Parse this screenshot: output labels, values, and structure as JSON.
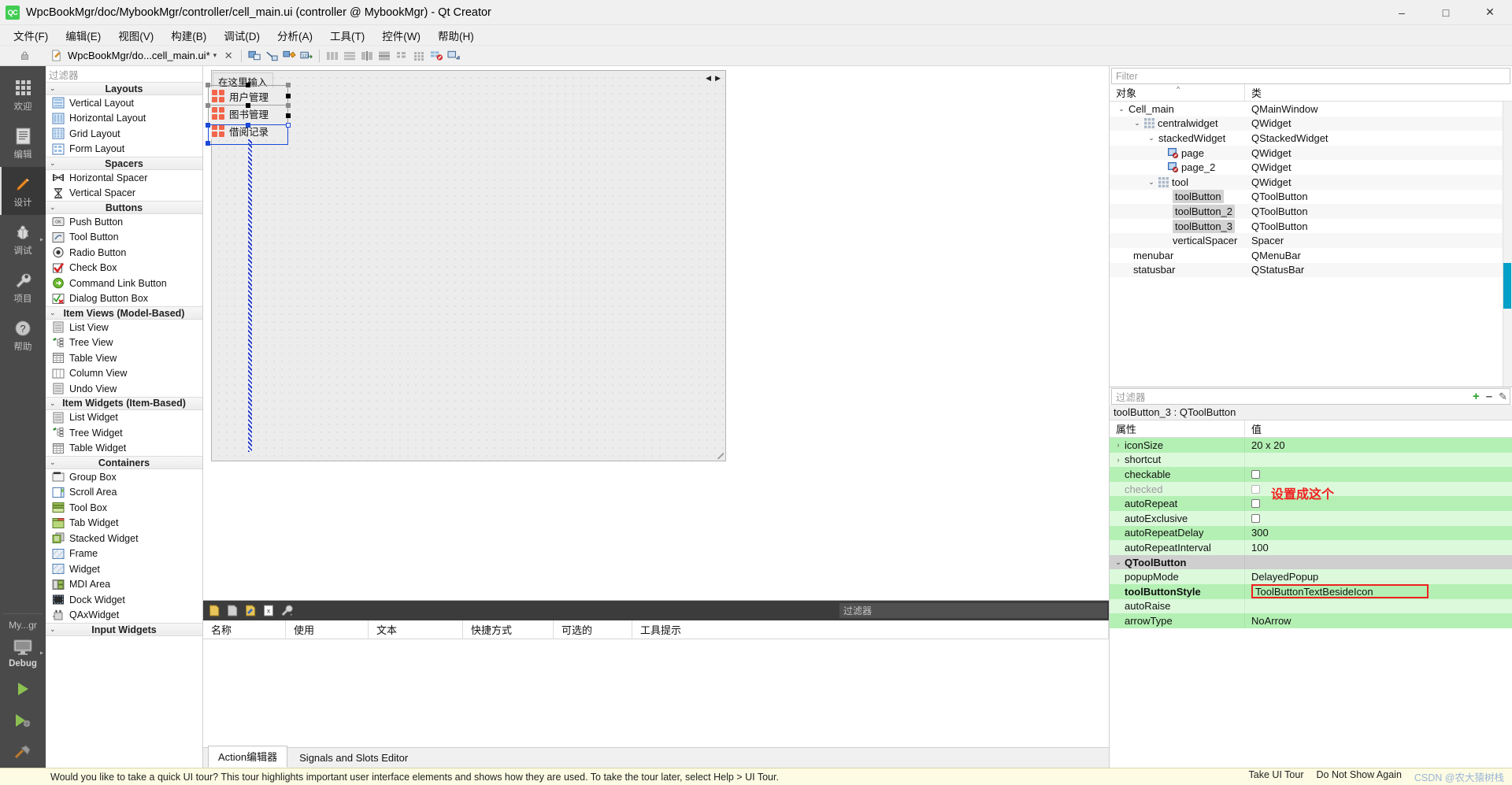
{
  "window": {
    "title": "WpcBookMgr/doc/MybookMgr/controller/cell_main.ui (controller @ MybookMgr) - Qt Creator",
    "logo": "QC",
    "minimize": "–",
    "maximize": "□",
    "close": "✕"
  },
  "menubar": [
    {
      "label": "文件(F)",
      "name": "menu-file"
    },
    {
      "label": "编辑(E)",
      "name": "menu-edit"
    },
    {
      "label": "视图(V)",
      "name": "menu-view"
    },
    {
      "label": "构建(B)",
      "name": "menu-build"
    },
    {
      "label": "调试(D)",
      "name": "menu-debug"
    },
    {
      "label": "分析(A)",
      "name": "menu-analyze"
    },
    {
      "label": "工具(T)",
      "name": "menu-tools"
    },
    {
      "label": "控件(W)",
      "name": "menu-widgets"
    },
    {
      "label": "帮助(H)",
      "name": "menu-help"
    }
  ],
  "toolbar": {
    "file_name": "WpcBookMgr/do...cell_main.ui*",
    "dropdown_glyph": "▾",
    "close_glyph": "✕"
  },
  "modebar": {
    "items": [
      {
        "label": "欢迎",
        "icon": "grid-icon",
        "active": false
      },
      {
        "label": "编辑",
        "icon": "document-icon",
        "active": false
      },
      {
        "label": "设计",
        "icon": "pencil-icon",
        "active": true
      },
      {
        "label": "调试",
        "icon": "bug-icon",
        "active": false,
        "arrow": "▸"
      },
      {
        "label": "项目",
        "icon": "wrench-icon",
        "active": false
      },
      {
        "label": "帮助",
        "icon": "question-icon",
        "active": false
      }
    ],
    "kit_label": "My...gr",
    "target_label": "Debug",
    "target_arrow": "▸"
  },
  "widgetbox": {
    "filter_placeholder": "过滤器",
    "groups": [
      {
        "title": "Layouts",
        "items": [
          {
            "label": "Vertical Layout",
            "icon": "vertical-layout-icon"
          },
          {
            "label": "Horizontal Layout",
            "icon": "horizontal-layout-icon"
          },
          {
            "label": "Grid Layout",
            "icon": "grid-layout-icon"
          },
          {
            "label": "Form Layout",
            "icon": "form-layout-icon"
          }
        ]
      },
      {
        "title": "Spacers",
        "items": [
          {
            "label": "Horizontal Spacer",
            "icon": "horizontal-spacer-icon"
          },
          {
            "label": "Vertical Spacer",
            "icon": "vertical-spacer-icon"
          }
        ]
      },
      {
        "title": "Buttons",
        "items": [
          {
            "label": "Push Button",
            "icon": "push-button-icon"
          },
          {
            "label": "Tool Button",
            "icon": "tool-button-icon"
          },
          {
            "label": "Radio Button",
            "icon": "radio-button-icon"
          },
          {
            "label": "Check Box",
            "icon": "check-box-icon"
          },
          {
            "label": "Command Link Button",
            "icon": "command-link-icon"
          },
          {
            "label": "Dialog Button Box",
            "icon": "dialog-button-box-icon"
          }
        ]
      },
      {
        "title": "Item Views (Model-Based)",
        "items": [
          {
            "label": "List View",
            "icon": "list-view-icon"
          },
          {
            "label": "Tree View",
            "icon": "tree-view-icon"
          },
          {
            "label": "Table View",
            "icon": "table-view-icon"
          },
          {
            "label": "Column View",
            "icon": "column-view-icon"
          },
          {
            "label": "Undo View",
            "icon": "undo-view-icon"
          }
        ]
      },
      {
        "title": "Item Widgets (Item-Based)",
        "items": [
          {
            "label": "List Widget",
            "icon": "list-widget-icon"
          },
          {
            "label": "Tree Widget",
            "icon": "tree-widget-icon"
          },
          {
            "label": "Table Widget",
            "icon": "table-widget-icon"
          }
        ]
      },
      {
        "title": "Containers",
        "items": [
          {
            "label": "Group Box",
            "icon": "group-box-icon"
          },
          {
            "label": "Scroll Area",
            "icon": "scroll-area-icon"
          },
          {
            "label": "Tool Box",
            "icon": "tool-box-icon"
          },
          {
            "label": "Tab Widget",
            "icon": "tab-widget-icon"
          },
          {
            "label": "Stacked Widget",
            "icon": "stacked-widget-icon"
          },
          {
            "label": "Frame",
            "icon": "frame-icon"
          },
          {
            "label": "Widget",
            "icon": "widget-icon"
          },
          {
            "label": "MDI Area",
            "icon": "mdi-area-icon"
          },
          {
            "label": "Dock Widget",
            "icon": "dock-widget-icon"
          },
          {
            "label": "QAxWidget",
            "icon": "qaxwidget-icon"
          }
        ]
      },
      {
        "title": "Input Widgets",
        "items": []
      }
    ]
  },
  "canvas": {
    "menu_placeholder": "在这里输入",
    "tool_buttons": [
      {
        "label": "用户管理"
      },
      {
        "label": "图书管理"
      },
      {
        "label": "借阅记录"
      }
    ]
  },
  "action_editor": {
    "filter_placeholder": "过滤器",
    "columns": [
      "名称",
      "使用",
      "文本",
      "快捷方式",
      "可选的",
      "工具提示"
    ],
    "rows": [],
    "tabs": [
      {
        "label": "Action编辑器",
        "active": true
      },
      {
        "label": "Signals and Slots Editor",
        "active": false
      }
    ]
  },
  "object_tree": {
    "filter_placeholder": "Filter",
    "columns": [
      "对象",
      "类"
    ],
    "sort_marker": "^",
    "rows": [
      {
        "name": "Cell_main",
        "cls": "QMainWindow",
        "indent": 0,
        "chev": "⌄",
        "icon": "",
        "highlight": false
      },
      {
        "name": "centralwidget",
        "cls": "QWidget",
        "indent": 1,
        "chev": "⌄",
        "icon": "grid-icon",
        "highlight": false
      },
      {
        "name": "stackedWidget",
        "cls": "QStackedWidget",
        "indent": 2,
        "chev": "⌄",
        "icon": "",
        "highlight": false
      },
      {
        "name": "page",
        "cls": "QWidget",
        "indent": 3,
        "chev": "",
        "icon": "page-icon",
        "highlight": false
      },
      {
        "name": "page_2",
        "cls": "QWidget",
        "indent": 3,
        "chev": "",
        "icon": "page-icon",
        "highlight": false
      },
      {
        "name": "tool",
        "cls": "QWidget",
        "indent": 2,
        "chev": "⌄",
        "icon": "grid-icon",
        "highlight": false
      },
      {
        "name": "toolButton",
        "cls": "QToolButton",
        "indent": 3,
        "chev": "",
        "icon": "",
        "highlight": true
      },
      {
        "name": "toolButton_2",
        "cls": "QToolButton",
        "indent": 3,
        "chev": "",
        "icon": "",
        "highlight": true
      },
      {
        "name": "toolButton_3",
        "cls": "QToolButton",
        "indent": 3,
        "chev": "",
        "icon": "",
        "highlight": true
      },
      {
        "name": "verticalSpacer",
        "cls": "Spacer",
        "indent": 3,
        "chev": "",
        "icon": "",
        "highlight": false
      },
      {
        "name": "menubar",
        "cls": "QMenuBar",
        "indent": 1,
        "chev": "",
        "icon": "",
        "highlight": false
      },
      {
        "name": "statusbar",
        "cls": "QStatusBar",
        "indent": 1,
        "chev": "",
        "icon": "",
        "highlight": false
      }
    ]
  },
  "property_editor": {
    "filter_placeholder": "过滤器",
    "add_glyph": "+",
    "remove_glyph": "–",
    "config_glyph": "✎",
    "selection": "toolButton_3 : QToolButton",
    "columns": [
      "属性",
      "值"
    ],
    "rows": [
      {
        "name": "iconSize",
        "value": "20 x 20",
        "type": "text",
        "expand": "›",
        "shade": "g1"
      },
      {
        "name": "shortcut",
        "value": "",
        "type": "text",
        "expand": "›",
        "shade": "g2"
      },
      {
        "name": "checkable",
        "value": "",
        "type": "checkbox",
        "expand": "",
        "shade": "g1"
      },
      {
        "name": "checked",
        "value": "",
        "type": "checkbox",
        "expand": "",
        "shade": "g2",
        "dim": true
      },
      {
        "name": "autoRepeat",
        "value": "",
        "type": "checkbox",
        "expand": "",
        "shade": "g1"
      },
      {
        "name": "autoExclusive",
        "value": "",
        "type": "checkbox",
        "expand": "",
        "shade": "g2"
      },
      {
        "name": "autoRepeatDelay",
        "value": "300",
        "type": "text",
        "expand": "",
        "shade": "g1"
      },
      {
        "name": "autoRepeatInterval",
        "value": "100",
        "type": "text",
        "expand": "",
        "shade": "g2"
      },
      {
        "name": "QToolButton",
        "value": "",
        "type": "group",
        "expand": "⌄",
        "shade": "group"
      },
      {
        "name": "popupMode",
        "value": "DelayedPopup",
        "type": "text",
        "expand": "",
        "shade": "g2"
      },
      {
        "name": "toolButtonStyle",
        "value": "ToolButtonTextBesideIcon",
        "type": "boxed",
        "expand": "",
        "shade": "g1",
        "bold": true
      },
      {
        "name": "autoRaise",
        "value": "",
        "type": "checkbox",
        "expand": "",
        "shade": "g2"
      },
      {
        "name": "arrowType",
        "value": "NoArrow",
        "type": "text",
        "expand": "",
        "shade": "g1"
      }
    ],
    "annotation": "设置成这个"
  },
  "tourbar": {
    "message": "Would you like to take a quick UI tour? This tour highlights important user interface elements and shows how they are used. To take the tour later, select Help > UI Tour.",
    "take_tour": "Take UI Tour",
    "do_not_show": "Do Not Show Again",
    "watermark": "CSDN @农大猿树栈"
  }
}
